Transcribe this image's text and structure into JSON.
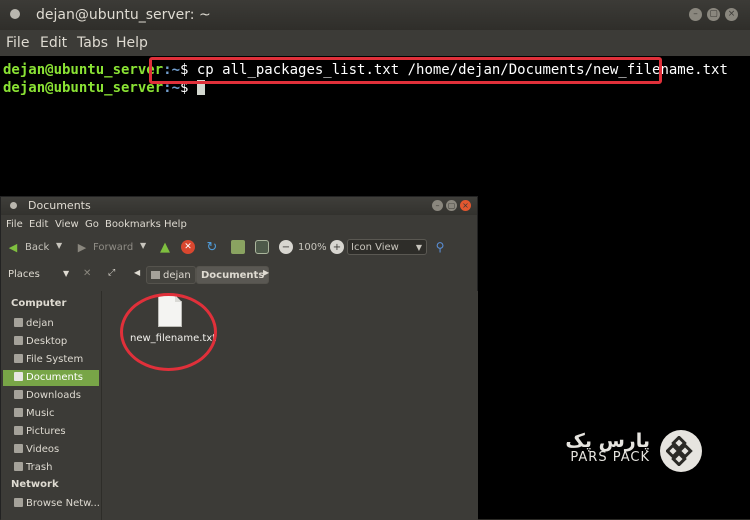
{
  "terminal": {
    "title": "dejan@ubuntu_server: ~",
    "menu": [
      "File",
      "Edit",
      "Tabs",
      "Help"
    ],
    "lines": [
      {
        "user": "dejan@ubuntu_server",
        "path": ":~",
        "prompt": "$ ",
        "command": "cp all_packages_list.txt /home/dejan/Documents/new_filename.txt"
      },
      {
        "user": "dejan@ubuntu_server",
        "path": ":~",
        "prompt": "$ ",
        "command": ""
      }
    ]
  },
  "file_manager": {
    "title": "Documents",
    "menu": [
      "File",
      "Edit",
      "View",
      "Go",
      "Bookmarks",
      "Help"
    ],
    "toolbar": {
      "back": "Back",
      "forward": "Forward",
      "zoom": "100%",
      "view_mode": "Icon View"
    },
    "location": {
      "places_label": "Places",
      "crumbs": [
        "dejan",
        "Documents"
      ]
    },
    "sidebar": {
      "computer_heading": "Computer",
      "computer_items": [
        "dejan",
        "Desktop",
        "File System",
        "Documents",
        "Downloads",
        "Music",
        "Pictures",
        "Videos",
        "Trash"
      ],
      "selected": "Documents",
      "network_heading": "Network",
      "network_items": [
        "Browse Netw..."
      ]
    },
    "files": [
      {
        "name": "new_filename.txt"
      }
    ]
  },
  "watermark": {
    "text_fa": "پارس پک",
    "text_en": "PARS PACK"
  },
  "colors": {
    "highlight": "#e0303a",
    "prompt_user": "#8ae234",
    "prompt_path": "#729fcf",
    "sidebar_selected": "#78a547"
  }
}
